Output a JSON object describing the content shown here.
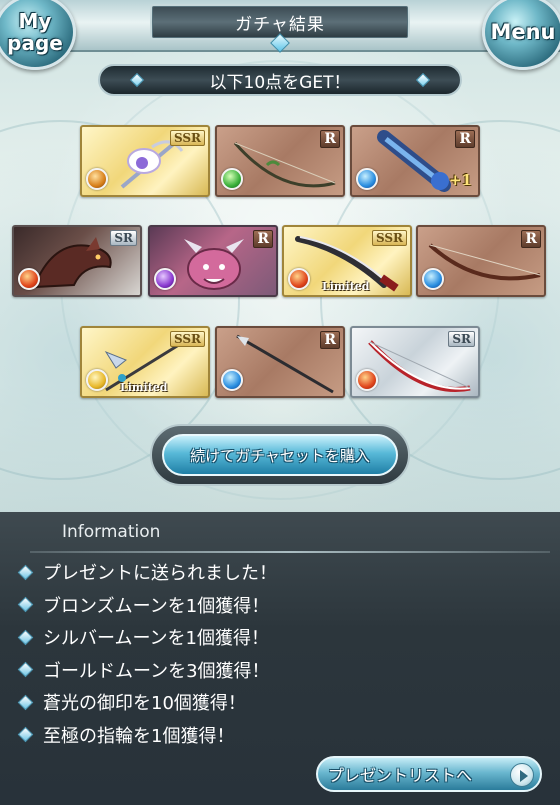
{
  "header": {
    "title": "ガチャ結果",
    "mypage_label": "My page",
    "menu_label": "Menu"
  },
  "banner": {
    "text": "以下10点をGET！"
  },
  "results": [
    {
      "rarity": "SSR",
      "element": "fire",
      "art": "dragon-staff",
      "limited": false,
      "badge": ""
    },
    {
      "rarity": "R",
      "element": "wind",
      "art": "bow-green",
      "limited": false,
      "badge": ""
    },
    {
      "rarity": "R",
      "element": "water",
      "art": "gauntlet",
      "limited": false,
      "badge": "+1"
    },
    {
      "rarity": "SR",
      "element": "fire",
      "art": "dragon-summon",
      "limited": false,
      "badge": ""
    },
    {
      "rarity": "R",
      "element": "dark",
      "art": "pink-dragon",
      "limited": false,
      "badge": ""
    },
    {
      "rarity": "SSR",
      "element": "fire",
      "art": "curved-blade",
      "limited": true,
      "badge": ""
    },
    {
      "rarity": "R",
      "element": "water",
      "art": "longbow",
      "limited": false,
      "badge": ""
    },
    {
      "rarity": "SSR",
      "element": "light",
      "art": "halberd",
      "limited": true,
      "badge": ""
    },
    {
      "rarity": "R",
      "element": "water",
      "art": "spear",
      "limited": false,
      "badge": ""
    },
    {
      "rarity": "SR",
      "element": "fire",
      "art": "red-bow",
      "limited": false,
      "badge": ""
    }
  ],
  "labels": {
    "limited": "Limited"
  },
  "buy_button": {
    "label": "続けてガチャセットを購入"
  },
  "information": {
    "title": "Information",
    "items": [
      "プレゼントに送られました！",
      "ブロンズムーンを1個獲得！",
      "シルバームーンを1個獲得！",
      "ゴールドムーンを3個獲得！",
      "蒼光の御印を10個獲得！",
      "至極の指輪を1個獲得！"
    ]
  },
  "present_button": {
    "label": "プレゼントリストへ"
  },
  "colors": {
    "accent": "#58b9d8",
    "panel": "#2c363c",
    "ssr_gold": "#f1d77a",
    "r_bronze": "#a87a64",
    "sr_silver": "#c9d3da"
  }
}
